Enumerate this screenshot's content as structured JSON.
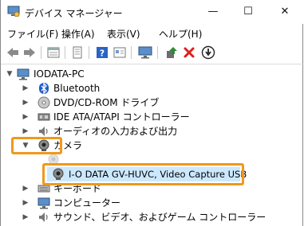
{
  "window": {
    "title": "デバイス マネージャー",
    "minimize": "—",
    "maximize": "☐",
    "close": "✕"
  },
  "menu": {
    "items": [
      "ファイル(F)",
      "操作(A)",
      "表示(V)",
      "ヘルプ(H)"
    ]
  },
  "toolbar": {
    "icons": [
      "back-arrow-icon",
      "forward-arrow-icon",
      "properties-icon",
      "driver-icon",
      "help-icon",
      "view-icon",
      "monitor-scan-icon",
      "update-driver-icon",
      "uninstall-x-icon",
      "download-icon"
    ],
    "colors": {
      "x_red": "#e01d1d",
      "help_blue": "#2a63c7",
      "update_green": "#2e8b3a"
    }
  },
  "tree": {
    "root": "IODATA-PC",
    "categories": [
      "Bluetooth",
      "DVD/CD-ROM ドライブ",
      "IDE ATA/ATAPI コントローラー",
      "オーディオの入力および出力",
      "カメラ",
      "キーボード",
      "コンピューター",
      "サウンド、ビデオ、およびゲーム コントローラー"
    ],
    "camera_device": "I-O DATA GV-HUVC, Video Capture USB"
  },
  "highlight_color": "#f0981c"
}
